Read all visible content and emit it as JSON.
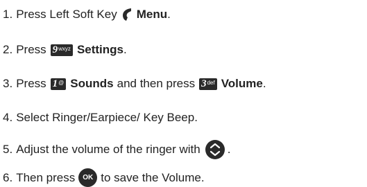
{
  "steps": [
    {
      "num": "1.",
      "pre": "Press Left Soft Key",
      "bold": "Menu",
      "post": "."
    },
    {
      "num": "2.",
      "pre": "Press",
      "key": {
        "digit": "9",
        "letters": "wxyz"
      },
      "bold": "Settings",
      "post": "."
    },
    {
      "num": "3.",
      "pre": "Press",
      "key": {
        "digit": "1",
        "letters": "@"
      },
      "bold": "Sounds",
      "mid": "and then press",
      "key2": {
        "digit": "3",
        "letters": "def"
      },
      "bold2": "Volume",
      "post": "."
    },
    {
      "num": "4.",
      "text": "Select Ringer/Earpiece/ Key Beep."
    },
    {
      "num": "5.",
      "pre": "Adjust the volume of the ringer with",
      "post": "."
    },
    {
      "num": "6.",
      "pre": "Then press",
      "ok": "OK",
      "post": "to save the Volume."
    }
  ],
  "icons": {
    "soft_key": "left-soft-key-icon",
    "nav_key": "navigation-key-icon",
    "ok_key": "ok-key-icon"
  },
  "colors": {
    "text": "#222222",
    "key": "#2a2a2a"
  }
}
